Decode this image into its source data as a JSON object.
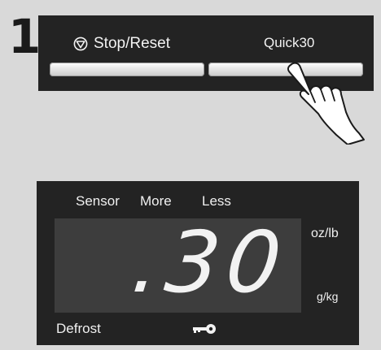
{
  "step": {
    "number": "1"
  },
  "control_panel": {
    "stop_reset_label": "Stop/Reset",
    "quick30_label": "Quick30"
  },
  "display": {
    "sensor_label": "Sensor",
    "more_label": "More",
    "less_label": "Less",
    "readout": ".30",
    "unit_oz_lb": "oz/lb",
    "unit_g_kg": "g/kg",
    "defrost_label": "Defrost"
  },
  "icons": [
    "stop-icon",
    "pointing-hand-icon",
    "key-icon"
  ],
  "colors": {
    "panel": "#232323",
    "screen": "#3d3d3d",
    "background": "#d9d9d9",
    "text": "#f2f2f2"
  }
}
